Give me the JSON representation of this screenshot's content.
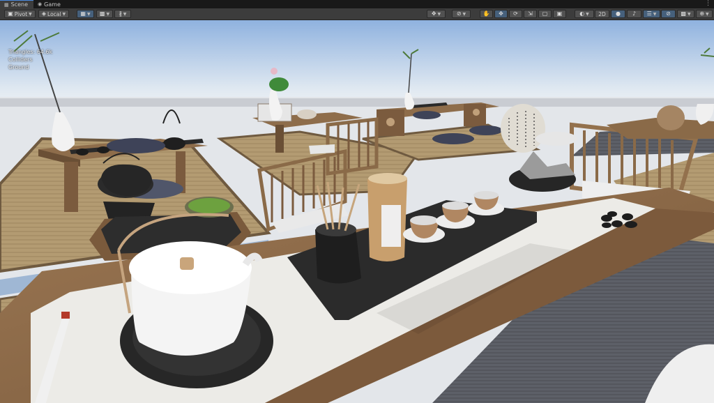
{
  "tabs": [
    {
      "label": "Scene",
      "icon": "scene-icon",
      "active": true
    },
    {
      "label": "Game",
      "icon": "game-controller-icon",
      "active": false
    }
  ],
  "toolbar": {
    "pivot_label": "Pivot",
    "local_label": "Local",
    "twod_label": "2D"
  },
  "overlay": {
    "line1": "Triangles: 64.6k",
    "line2": "Colliders",
    "line3": "Ground"
  },
  "colors": {
    "toolbar_bg": "#3c3c3c",
    "tab_bg": "#191919",
    "selected_button": "#46607c",
    "sky_top": "#8fb2df",
    "horizon": "#e9eef3",
    "table_wood": "#8a6a4a",
    "tatami": "#b49a6e"
  }
}
